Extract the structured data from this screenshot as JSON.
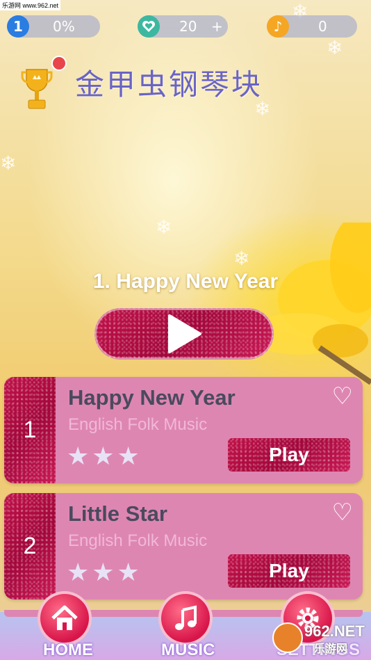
{
  "watermark": "乐游网 www.962.net",
  "top_bar": {
    "level": "1",
    "progress": "0%",
    "hearts": "20",
    "hearts_add": "+",
    "notes": "0",
    "colors": {
      "level": "#2a7de1",
      "heart": "#3cb8a0",
      "note": "#f5a623"
    }
  },
  "app_title": "金甲虫钢琴块",
  "now_playing": "1. Happy New Year",
  "songs": [
    {
      "number": "1",
      "name": "Happy New Year",
      "artist": "English Folk Music",
      "stars": "★★★",
      "play_label": "Play"
    },
    {
      "number": "2",
      "name": "Little Star",
      "artist": "English Folk Music",
      "stars": "★★★",
      "play_label": "Play"
    }
  ],
  "nav": {
    "home": "HOME",
    "music": "MUSIC",
    "settings": "SETTINGS"
  },
  "corner_logo": {
    "main": "962.NET",
    "sub": "乐游网"
  }
}
